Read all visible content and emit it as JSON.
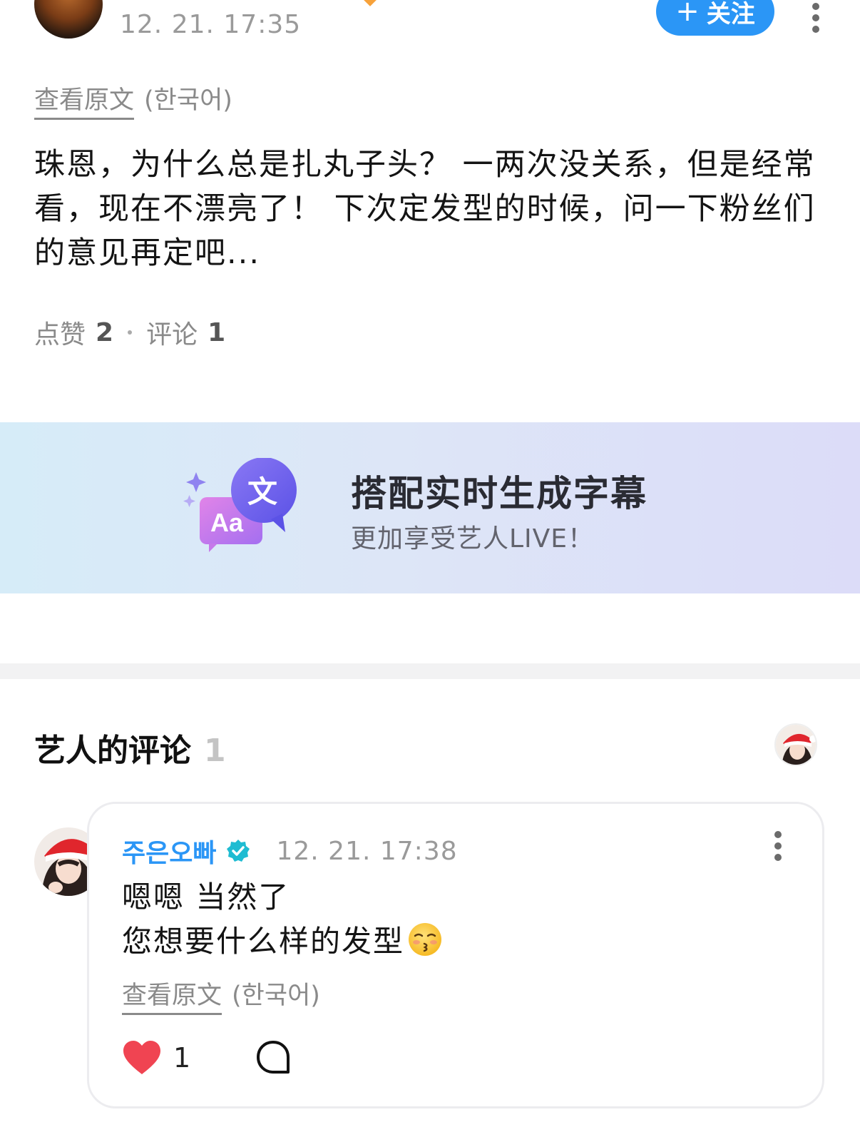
{
  "post": {
    "time": "12. 21. 17:35",
    "follow_label": "关注",
    "follow_plus": "+",
    "view_original": "查看原文",
    "original_lang": "(한국어)",
    "body": "珠恩，为什么总是扎丸子头？ 一两次没关系，但是经常看，现在不漂亮了！ 下次定发型的时候，问一下粉丝们的意见再定吧...",
    "likes_label": "点赞",
    "likes_count": "2",
    "comments_label": "评论",
    "comments_count": "1"
  },
  "banner": {
    "title": "搭配实时生成字幕",
    "subtitle": "更加享受艺人LIVE！",
    "icon_text_aa": "Aa",
    "icon_text_wen": "文"
  },
  "artist_comments": {
    "title": "艺人的评论",
    "count": "1"
  },
  "comment": {
    "author": "주은오빠",
    "time": "12. 21. 17:38",
    "line1": "嗯嗯 当然了",
    "line2": "您想要什么样的发型",
    "view_original": "查看原文",
    "original_lang": "(한국어)",
    "like_count": "1"
  },
  "colors": {
    "accent_blue": "#2b96f6",
    "verified_teal": "#1fbcd2",
    "heart_red": "#f04452"
  },
  "icons": [
    "chevron-kebab-icon",
    "verified-badge-icon",
    "heart-icon",
    "comment-bubble-icon",
    "subtitle-translate-icon",
    "sparkle-icon",
    "kissing-face-emoji"
  ]
}
